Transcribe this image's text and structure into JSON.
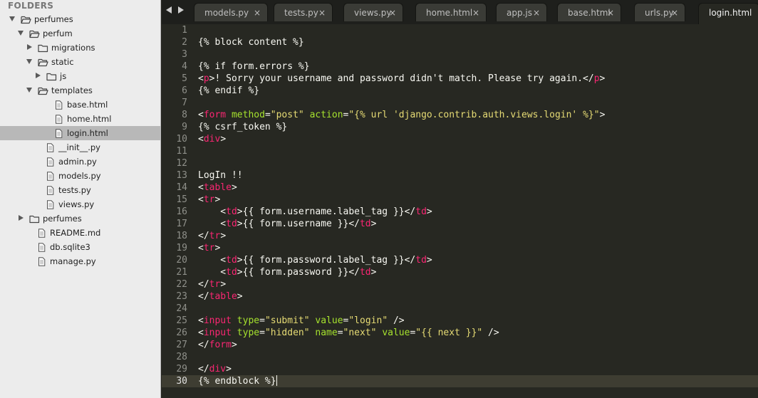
{
  "sidebar": {
    "header": "FOLDERS",
    "items": [
      {
        "label": "perfumes",
        "kind": "folder-open",
        "depth": 0,
        "arrow": "open"
      },
      {
        "label": "perfum",
        "kind": "folder-open",
        "depth": 1,
        "arrow": "open"
      },
      {
        "label": "migrations",
        "kind": "folder",
        "depth": 2,
        "arrow": "closed"
      },
      {
        "label": "static",
        "kind": "folder-open",
        "depth": 2,
        "arrow": "open"
      },
      {
        "label": "js",
        "kind": "folder",
        "depth": 3,
        "arrow": "closed"
      },
      {
        "label": "templates",
        "kind": "folder-open",
        "depth": 2,
        "arrow": "open"
      },
      {
        "label": "base.html",
        "kind": "file",
        "depth": 3,
        "arrow": "none"
      },
      {
        "label": "home.html",
        "kind": "file",
        "depth": 3,
        "arrow": "none"
      },
      {
        "label": "login.html",
        "kind": "file",
        "depth": 3,
        "arrow": "none",
        "selected": true
      },
      {
        "label": "__init__.py",
        "kind": "file",
        "depth": 2,
        "arrow": "none"
      },
      {
        "label": "admin.py",
        "kind": "file",
        "depth": 2,
        "arrow": "none"
      },
      {
        "label": "models.py",
        "kind": "file",
        "depth": 2,
        "arrow": "none"
      },
      {
        "label": "tests.py",
        "kind": "file",
        "depth": 2,
        "arrow": "none"
      },
      {
        "label": "views.py",
        "kind": "file",
        "depth": 2,
        "arrow": "none"
      },
      {
        "label": "perfumes",
        "kind": "folder",
        "depth": 1,
        "arrow": "closed"
      },
      {
        "label": "README.md",
        "kind": "file",
        "depth": 1,
        "arrow": "none"
      },
      {
        "label": "db.sqlite3",
        "kind": "file",
        "depth": 1,
        "arrow": "none"
      },
      {
        "label": "manage.py",
        "kind": "file",
        "depth": 1,
        "arrow": "none"
      }
    ]
  },
  "tabs": [
    {
      "label": "models.py",
      "close": "×"
    },
    {
      "label": "tests.py",
      "close": "×"
    },
    {
      "label": "views.py",
      "close": "×"
    },
    {
      "label": "home.html",
      "close": "×"
    },
    {
      "label": "app.js",
      "close": "×"
    },
    {
      "label": "base.html",
      "close": "×"
    },
    {
      "label": "urls.py",
      "close": "×"
    },
    {
      "label": "login.html",
      "close": "",
      "active": true
    }
  ],
  "editor": {
    "current_line": 30,
    "syntax_colors": {
      "plain": "#f8f8f2",
      "tag": "#f92672",
      "attr": "#a6e22e",
      "string": "#e6db74"
    },
    "lines": [
      [],
      [
        [
          "p",
          "{% block content %}"
        ]
      ],
      [],
      [
        [
          "p",
          "{% if form.errors %}"
        ]
      ],
      [
        [
          "p",
          "<"
        ],
        [
          "t",
          "p"
        ],
        [
          "p",
          ">! Sorry your username and password didn't match. Please try again.</"
        ],
        [
          "t",
          "p"
        ],
        [
          "p",
          ">"
        ]
      ],
      [
        [
          "p",
          "{% endif %}"
        ]
      ],
      [],
      [
        [
          "p",
          "<"
        ],
        [
          "t",
          "form"
        ],
        [
          "p",
          " "
        ],
        [
          "a",
          "method"
        ],
        [
          "p",
          "="
        ],
        [
          "s",
          "\"post\""
        ],
        [
          "p",
          " "
        ],
        [
          "a",
          "action"
        ],
        [
          "p",
          "="
        ],
        [
          "s",
          "\"{% url 'django.contrib.auth.views.login' %}\""
        ],
        [
          "p",
          ">"
        ]
      ],
      [
        [
          "p",
          "{% csrf_token %}"
        ]
      ],
      [
        [
          "p",
          "<"
        ],
        [
          "t",
          "div"
        ],
        [
          "p",
          ">"
        ]
      ],
      [],
      [],
      [
        [
          "p",
          "LogIn !!"
        ]
      ],
      [
        [
          "p",
          "<"
        ],
        [
          "t",
          "table"
        ],
        [
          "p",
          ">"
        ]
      ],
      [
        [
          "p",
          "<"
        ],
        [
          "t",
          "tr"
        ],
        [
          "p",
          ">"
        ]
      ],
      [
        [
          "p",
          "    <"
        ],
        [
          "t",
          "td"
        ],
        [
          "p",
          ">{{ form.username.label_tag }}</"
        ],
        [
          "t",
          "td"
        ],
        [
          "p",
          ">"
        ]
      ],
      [
        [
          "p",
          "    <"
        ],
        [
          "t",
          "td"
        ],
        [
          "p",
          ">{{ form.username }}</"
        ],
        [
          "t",
          "td"
        ],
        [
          "p",
          ">"
        ]
      ],
      [
        [
          "p",
          "</"
        ],
        [
          "t",
          "tr"
        ],
        [
          "p",
          ">"
        ]
      ],
      [
        [
          "p",
          "<"
        ],
        [
          "t",
          "tr"
        ],
        [
          "p",
          ">"
        ]
      ],
      [
        [
          "p",
          "    <"
        ],
        [
          "t",
          "td"
        ],
        [
          "p",
          ">{{ form.password.label_tag }}</"
        ],
        [
          "t",
          "td"
        ],
        [
          "p",
          ">"
        ]
      ],
      [
        [
          "p",
          "    <"
        ],
        [
          "t",
          "td"
        ],
        [
          "p",
          ">{{ form.password }}</"
        ],
        [
          "t",
          "td"
        ],
        [
          "p",
          ">"
        ]
      ],
      [
        [
          "p",
          "</"
        ],
        [
          "t",
          "tr"
        ],
        [
          "p",
          ">"
        ]
      ],
      [
        [
          "p",
          "</"
        ],
        [
          "t",
          "table"
        ],
        [
          "p",
          ">"
        ]
      ],
      [],
      [
        [
          "p",
          "<"
        ],
        [
          "t",
          "input"
        ],
        [
          "p",
          " "
        ],
        [
          "a",
          "type"
        ],
        [
          "p",
          "="
        ],
        [
          "s",
          "\"submit\""
        ],
        [
          "p",
          " "
        ],
        [
          "a",
          "value"
        ],
        [
          "p",
          "="
        ],
        [
          "s",
          "\"login\""
        ],
        [
          "p",
          " />"
        ]
      ],
      [
        [
          "p",
          "<"
        ],
        [
          "t",
          "input"
        ],
        [
          "p",
          " "
        ],
        [
          "a",
          "type"
        ],
        [
          "p",
          "="
        ],
        [
          "s",
          "\"hidden\""
        ],
        [
          "p",
          " "
        ],
        [
          "a",
          "name"
        ],
        [
          "p",
          "="
        ],
        [
          "s",
          "\"next\""
        ],
        [
          "p",
          " "
        ],
        [
          "a",
          "value"
        ],
        [
          "p",
          "="
        ],
        [
          "s",
          "\"{{ next }}\""
        ],
        [
          "p",
          " />"
        ]
      ],
      [
        [
          "p",
          "</"
        ],
        [
          "t",
          "form"
        ],
        [
          "p",
          ">"
        ]
      ],
      [],
      [
        [
          "p",
          "</"
        ],
        [
          "t",
          "div"
        ],
        [
          "p",
          ">"
        ]
      ],
      [
        [
          "p",
          "{% endblock %}"
        ]
      ]
    ]
  }
}
